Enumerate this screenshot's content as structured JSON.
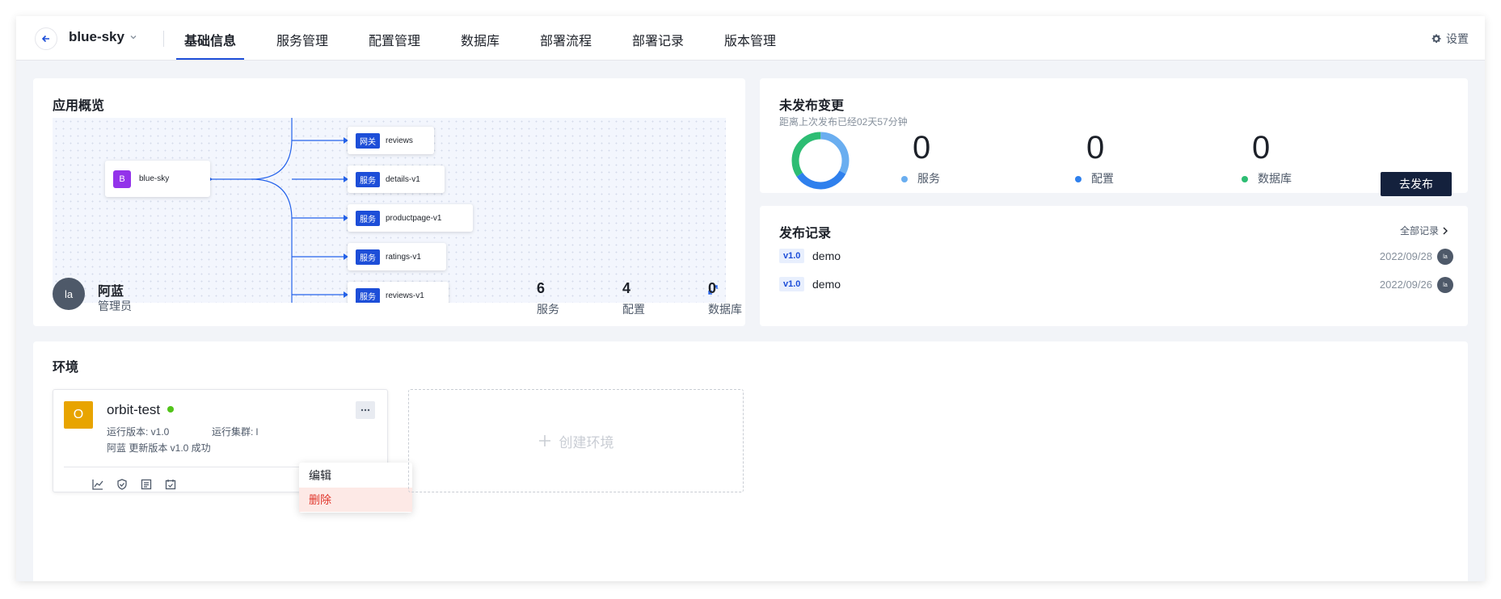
{
  "nav": {
    "app_name": "blue-sky",
    "tabs": [
      "基础信息",
      "服务管理",
      "配置管理",
      "数据库",
      "部署流程",
      "部署记录",
      "版本管理"
    ],
    "active_tab": "基础信息",
    "settings_label": "设置"
  },
  "overview": {
    "title": "应用概览",
    "root_node": {
      "icon_letter": "B",
      "label": "blue-sky"
    },
    "nodes": [
      {
        "badge": "网关",
        "label": "reviews"
      },
      {
        "badge": "服务",
        "label": "details-v1"
      },
      {
        "badge": "服务",
        "label": "productpage-v1"
      },
      {
        "badge": "服务",
        "label": "ratings-v1"
      },
      {
        "badge": "服务",
        "label": "reviews-v1"
      }
    ],
    "owner": {
      "avatar": "la",
      "name": "阿蓝",
      "role": "管理员"
    },
    "stats": [
      {
        "value": "6",
        "label": "服务"
      },
      {
        "value": "4",
        "label": "配置"
      },
      {
        "value": "0",
        "label": "数据库"
      }
    ]
  },
  "unpublished": {
    "title": "未发布变更",
    "subtitle": "距离上次发布已经02天57分钟",
    "items": [
      {
        "value": "0",
        "label": "服务",
        "color": "#6aaef0"
      },
      {
        "value": "0",
        "label": "配置",
        "color": "#2f80ed"
      },
      {
        "value": "0",
        "label": "数据库",
        "color": "#2dbd73"
      }
    ],
    "publish_label": "去发布"
  },
  "records": {
    "title": "发布记录",
    "all_label": "全部记录",
    "items": [
      {
        "version": "v1.0",
        "name": "demo",
        "date": "2022/09/28",
        "avatar": "la"
      },
      {
        "version": "v1.0",
        "name": "demo",
        "date": "2022/09/26",
        "avatar": "la"
      }
    ]
  },
  "environments": {
    "title": "环境",
    "env": {
      "icon_letter": "O",
      "name": "orbit-test",
      "status_color": "#52c41a",
      "version_label": "运行版本: v1.0",
      "cluster_label": "运行集群: l",
      "last_action": "阿蓝 更新版本 v1.0 成功"
    },
    "menu": [
      "编辑",
      "删除"
    ],
    "create_label": "创建环境"
  }
}
